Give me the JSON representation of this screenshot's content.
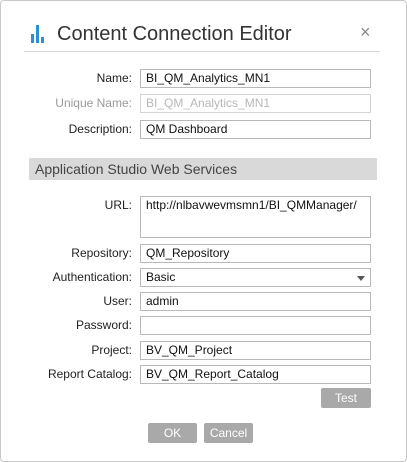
{
  "dialog": {
    "title": "Content Connection Editor",
    "close_symbol": "×"
  },
  "colors": {
    "accent": "#2b8fd6",
    "button": "#a9a9a9",
    "section_bg": "#d9d9d9"
  },
  "icons": {
    "app": "bar-chart-icon",
    "close": "close-icon",
    "select": "chevron-down-icon"
  },
  "fields": {
    "name": {
      "label": "Name:",
      "value": "BI_QM_Analytics_MN1"
    },
    "unique_name": {
      "label": "Unique Name:",
      "value": "BI_QM_Analytics_MN1"
    },
    "description": {
      "label": "Description:",
      "value": "QM Dashboard"
    }
  },
  "section": {
    "title": "Application Studio Web Services"
  },
  "service": {
    "url": {
      "label": "URL:",
      "value": "http://nlbavwevmsmn1/BI_QMManager/"
    },
    "repository": {
      "label": "Repository:",
      "value": "QM_Repository"
    },
    "authentication": {
      "label": "Authentication:",
      "value": "Basic"
    },
    "user": {
      "label": "User:",
      "value": "admin"
    },
    "password": {
      "label": "Password:",
      "value": ""
    },
    "project": {
      "label": "Project:",
      "value": "BV_QM_Project"
    },
    "report_catalog": {
      "label": "Report Catalog:",
      "value": "BV_QM_Report_Catalog"
    }
  },
  "buttons": {
    "test": "Test",
    "ok": "OK",
    "cancel": "Cancel"
  }
}
